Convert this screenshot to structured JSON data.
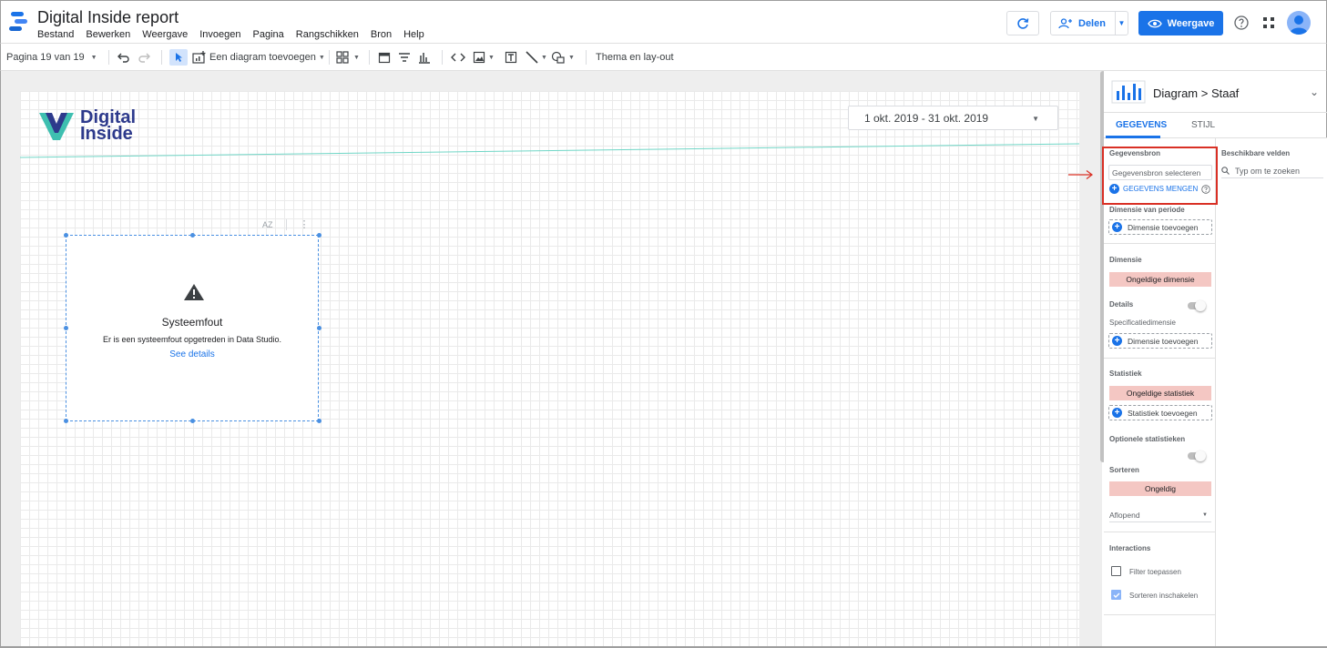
{
  "header": {
    "title": "Digital Inside report",
    "menu": [
      "Bestand",
      "Bewerken",
      "Weergave",
      "Invoegen",
      "Pagina",
      "Rangschikken",
      "Bron",
      "Help"
    ],
    "share_label": "Delen",
    "view_label": "Weergave"
  },
  "toolbar": {
    "page_label": "Pagina 19 van 19",
    "add_chart_label": "Een diagram toevoegen",
    "theme_label": "Thema en lay-out"
  },
  "canvas": {
    "brand_line1": "Digital",
    "brand_line2": "Inside",
    "date_range": "1 okt. 2019 - 31 okt. 2019",
    "chart_tool_sort": "AZ",
    "error": {
      "title": "Systeemfout",
      "message": "Er is een systeemfout opgetreden in Data Studio.",
      "link": "See details"
    }
  },
  "panel": {
    "breadcrumb": "Diagram > Staaf",
    "tabs": [
      "GEGEVENS",
      "STIJL"
    ],
    "data_source_label": "Gegevensbron",
    "data_source_placeholder": "Gegevensbron selecteren",
    "blend_label": "GEGEVENS MENGEN",
    "date_dimension_label": "Dimensie van periode",
    "add_dimension": "Dimensie toevoegen",
    "dimension_label": "Dimensie",
    "invalid_dimension": "Ongeldige dimensie",
    "details_label": "Details",
    "breakdown_label": "Specificatiedimensie",
    "metric_label": "Statistiek",
    "invalid_metric": "Ongeldige statistiek",
    "add_metric": "Statistiek toevoegen",
    "optional_metrics_label": "Optionele statistieken",
    "sort_label": "Sorteren",
    "invalid_sort": "Ongeldig",
    "sort_order": "Aflopend",
    "interactions_label": "Interactions",
    "apply_filter": "Filter toepassen",
    "enable_sort": "Sorteren inschakelen",
    "available_fields_label": "Beschikbare velden",
    "search_placeholder": "Typ om te zoeken"
  },
  "colors": {
    "accent": "#1a73e8",
    "invalid": "#f4c7c3",
    "highlight": "#d93025"
  }
}
